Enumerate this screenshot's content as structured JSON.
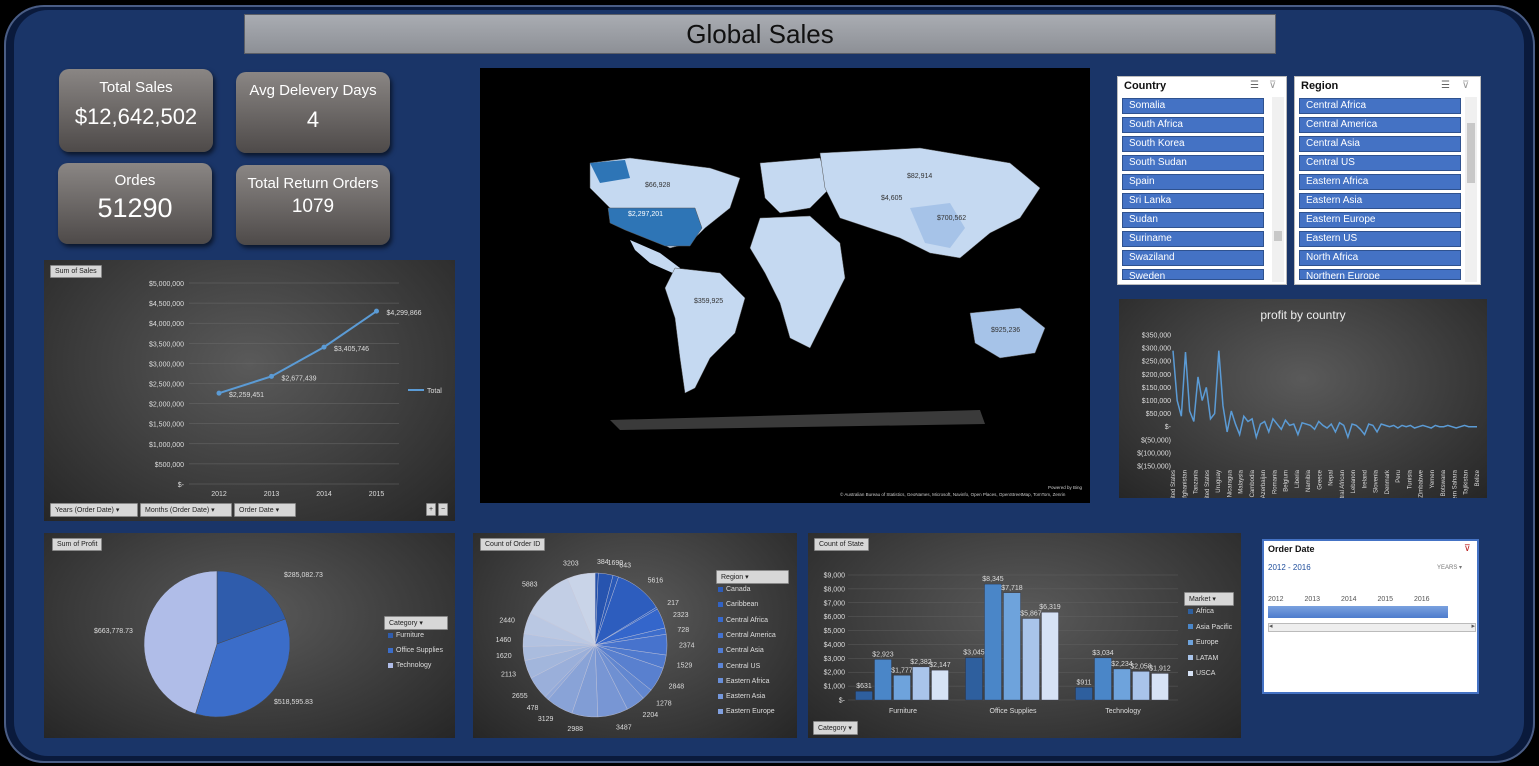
{
  "title": "Global Sales",
  "kpis": {
    "total_sales": {
      "label": "Total Sales",
      "value": "$12,642,502"
    },
    "avg_delivery": {
      "label": "Avg Delevery Days",
      "value": "4"
    },
    "orders": {
      "label": "Ordes",
      "value": "51290"
    },
    "returns": {
      "label": "Total Return Orders",
      "value": "1079"
    }
  },
  "map": {
    "labels": [
      "$66,928",
      "$82,914",
      "$2,297,201",
      "$4,605",
      "$700,562",
      "$359,925",
      "$925,236"
    ],
    "powered": "Powered by Bing",
    "credit": "© Australian Bureau of Statistics, GeoNames, Microsoft, Navinfo, Open Places, OpenStreetMap, TomTom, Zenrin"
  },
  "slicers": {
    "country": {
      "title": "Country",
      "items": [
        "Somalia",
        "South Africa",
        "South Korea",
        "South Sudan",
        "Spain",
        "Sri Lanka",
        "Sudan",
        "Suriname",
        "Swaziland",
        "Sweden"
      ]
    },
    "region": {
      "title": "Region",
      "items": [
        "Central Africa",
        "Central America",
        "Central Asia",
        "Central US",
        "Eastern Africa",
        "Eastern Asia",
        "Eastern Europe",
        "Eastern US",
        "North Africa",
        "Northern Europe"
      ]
    }
  },
  "timeline": {
    "title": "Order Date",
    "range": "2012 - 2016",
    "level": "YEARS",
    "years": [
      "2012",
      "2013",
      "2014",
      "2015",
      "2016"
    ]
  },
  "buttons": {
    "years": "Years (Order Date)",
    "months": "Months (Order Date)",
    "order_date": "Order Date",
    "category_pie": "Category",
    "region_pie": "Region",
    "market": "Market",
    "category_bar": "Category",
    "plus": "+",
    "minus": "−"
  },
  "chart_data": [
    {
      "type": "line",
      "title": "Sum of Sales",
      "categories": [
        "2012",
        "2013",
        "2014",
        "2015"
      ],
      "series": [
        {
          "name": "Total",
          "values": [
            2259451,
            2677439,
            3405746,
            4299866
          ]
        }
      ],
      "data_labels": [
        "$2,259,451",
        "$2,677,439",
        "$3,405,746",
        "$4,299,866"
      ],
      "ylim": [
        0,
        5000000
      ],
      "yticks": [
        "$-",
        "$500,000",
        "$1,000,000",
        "$1,500,000",
        "$2,000,000",
        "$2,500,000",
        "$3,000,000",
        "$3,500,000",
        "$4,000,000",
        "$4,500,000",
        "$5,000,000"
      ],
      "color": "#5b9bd5",
      "grid": true,
      "legend": "right"
    },
    {
      "type": "line",
      "title": "profit by country",
      "ylim": [
        -150000,
        350000
      ],
      "yticks": [
        "$(150,000)",
        "$(100,000)",
        "$(50,000)",
        "$-",
        "$50,000",
        "$100,000",
        "$150,000",
        "$200,000",
        "$250,000",
        "$300,000",
        "$350,000"
      ],
      "x": [
        "United States",
        "Afghanistan",
        "Tanzania",
        "United States",
        "Uruguay",
        "Nicaragua",
        "Malaysia",
        "Cambodia",
        "Azerbaijan",
        "Romania",
        "Belgium",
        "Liberia",
        "Namibia",
        "Greece",
        "Nepal",
        "Central African",
        "Lebanon",
        "Ireland",
        "Slovenia",
        "Denmark",
        "Peru",
        "Tunisia",
        "Zimbabwe",
        "Yemen",
        "Botswana",
        "Western Sahara",
        "Tajikistan",
        "Belize"
      ],
      "values": [
        290000,
        100000,
        40000,
        285000,
        60000,
        20000,
        190000,
        100000,
        150000,
        30000,
        50000,
        290000,
        80000,
        -20000,
        60000,
        10000,
        -30000,
        40000,
        20000,
        30000,
        -40000,
        10000,
        20000,
        -20000,
        30000,
        10000,
        -10000,
        25000,
        5000,
        10000,
        -30000,
        15000,
        10000,
        5000,
        -10000,
        20000,
        5000,
        -5000,
        10000,
        -20000,
        15000,
        5000,
        -40000,
        10000,
        5000,
        -10000,
        -30000,
        10000,
        5000,
        -20000,
        10000,
        5000,
        0,
        5000,
        -5000,
        5000,
        0,
        5000,
        -5000,
        0,
        5000,
        0,
        -5000,
        5000,
        0,
        0,
        5000,
        0,
        -5000,
        0,
        5000,
        0,
        0,
        0
      ],
      "color": "#5b9bd5"
    },
    {
      "type": "pie",
      "title": "Sum of Profit",
      "categories": [
        "Furniture",
        "Office Supplies",
        "Technology"
      ],
      "values": [
        285082.73,
        518595.83,
        663778.73
      ],
      "data_labels": [
        "$285,082.73",
        "$518,595.83",
        "$663,778.73"
      ],
      "colors": [
        "#2f5cac",
        "#3b6dc9",
        "#b0bde8"
      ],
      "legend": "right"
    },
    {
      "type": "pie",
      "title": "Count of Order ID",
      "categories": [
        "Canada",
        "Caribbean",
        "Central Africa",
        "Central America",
        "Central Asia",
        "Central US",
        "Eastern Africa",
        "Eastern Asia",
        "Eastern Europe"
      ],
      "values": [
        384,
        1690,
        643,
        5616,
        217,
        2323,
        728,
        2374,
        1529,
        2848,
        1278,
        2204,
        3487,
        2988,
        3129,
        478,
        2655,
        2113,
        1620,
        1460,
        2440,
        5883,
        3203
      ],
      "data_labels": [
        "384",
        "1690",
        "643",
        "5616",
        "217",
        "2323",
        "728",
        "2374",
        "1529",
        "2848",
        "1278",
        "2204",
        "3487",
        "2988",
        "3129",
        "478",
        "2655",
        "2113",
        "1620",
        "1460",
        "2440",
        "5883",
        "3203"
      ],
      "legend": "right"
    },
    {
      "type": "bar",
      "title": "Count of State",
      "categories": [
        "Furniture",
        "Office Supplies",
        "Technology"
      ],
      "series": [
        {
          "name": "Africa",
          "values": [
            631,
            3045,
            911
          ]
        },
        {
          "name": "Asia Pacific",
          "values": [
            2923,
            8345,
            3034
          ]
        },
        {
          "name": "Europe",
          "values": [
            1777,
            7718,
            2234
          ]
        },
        {
          "name": "LATAM",
          "values": [
            2382,
            5867,
            2058
          ]
        },
        {
          "name": "USCA",
          "values": [
            2147,
            6319,
            1912
          ]
        }
      ],
      "data_labels": [
        [
          "$631",
          "$2,923",
          "$1,777",
          "$2,382",
          "$2,147"
        ],
        [
          "$3,045",
          "$8,345",
          "$7,718",
          "$5,867",
          "$6,319"
        ],
        [
          "$911",
          "$3,034",
          "$2,234",
          "$2,058",
          "$1,912"
        ]
      ],
      "ylim": [
        0,
        9000
      ],
      "yticks": [
        "$-",
        "$1,000",
        "$2,000",
        "$3,000",
        "$4,000",
        "$5,000",
        "$6,000",
        "$7,000",
        "$8,000",
        "$9,000"
      ],
      "colors": [
        "#2e5f9e",
        "#4a86c8",
        "#6ea3dc",
        "#a9c4ea",
        "#d6e2f5"
      ],
      "legend": "right"
    }
  ]
}
